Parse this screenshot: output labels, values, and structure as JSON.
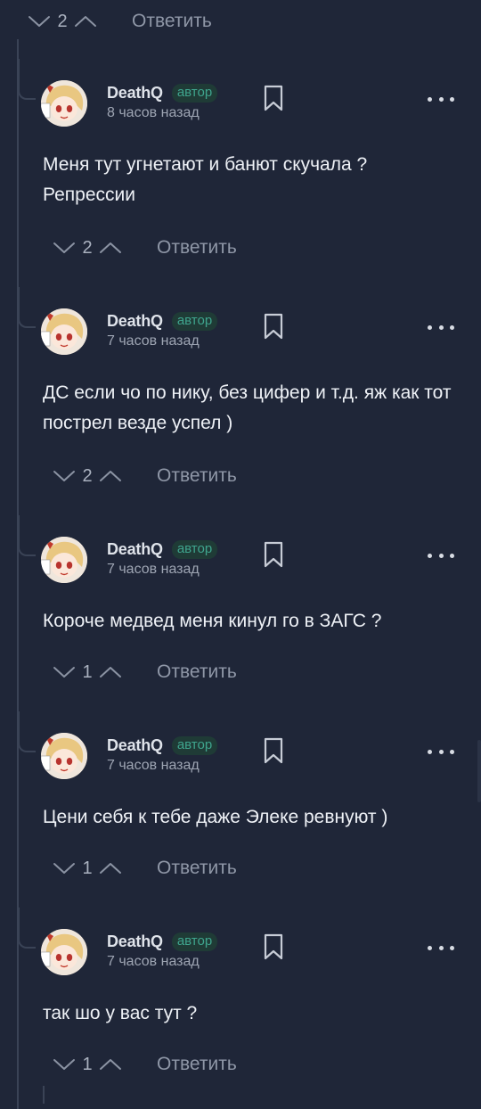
{
  "top_votes": {
    "count": "2",
    "reply_label": "Ответить"
  },
  "comments": [
    {
      "author": "DeathQ",
      "badge": "автор",
      "time": "8 часов назад",
      "text": "Меня тут угнетают и банют скучала ? Репрессии",
      "votes": "2",
      "reply_label": "Ответить"
    },
    {
      "author": "DeathQ",
      "badge": "автор",
      "time": "7 часов назад",
      "text": "ДС если чо по нику, без цифер и т.д. яж как тот пострел везде успел )",
      "votes": "2",
      "reply_label": "Ответить"
    },
    {
      "author": "DeathQ",
      "badge": "автор",
      "time": "7 часов назад",
      "text": "Короче медвед меня кинул го в ЗАГС ?",
      "votes": "1",
      "reply_label": "Ответить"
    },
    {
      "author": "DeathQ",
      "badge": "автор",
      "time": "7 часов назад",
      "text": "Цени себя к тебе даже Элеке ревнуют )",
      "votes": "1",
      "reply_label": "Ответить"
    },
    {
      "author": "DeathQ",
      "badge": "автор",
      "time": "7 часов назад",
      "text": "так шо у вас тут ?",
      "votes": "1",
      "reply_label": "Ответить"
    }
  ],
  "colors": {
    "background": "#1f2638",
    "badge_text": "#3fa58e",
    "badge_bg": "#1f3b36",
    "muted_text": "#8f97a7"
  },
  "icons": {
    "downvote": "chevron-down-icon",
    "upvote": "chevron-up-icon",
    "bookmark": "bookmark-icon",
    "more": "more-dots-icon"
  }
}
